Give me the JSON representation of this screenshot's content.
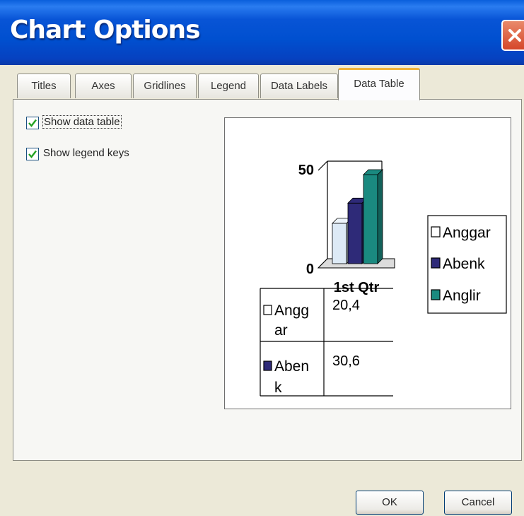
{
  "window": {
    "title": "Chart Options"
  },
  "tabs": [
    "Titles",
    "Axes",
    "Gridlines",
    "Legend",
    "Data Labels",
    "Data Table"
  ],
  "active_tab": "Data Table",
  "options": {
    "show_data_table": {
      "label": "Show data table",
      "checked": true
    },
    "show_legend_keys": {
      "label": "Show legend keys",
      "checked": true
    }
  },
  "preview": {
    "y_max_label": "50",
    "y_min_label": "0",
    "category_label": "1st Qtr",
    "legend": [
      {
        "label": "Anggar",
        "color": "#ffffff"
      },
      {
        "label": "Abenk",
        "color": "#2e2a78"
      },
      {
        "label": "Anglir",
        "color": "#1a8a80"
      }
    ],
    "table_rows": [
      {
        "key_color": "#ffffff",
        "name_line1": "Angg",
        "name_line2": "ar",
        "value": "20,4"
      },
      {
        "key_color": "#2e2a78",
        "name_line1": "Aben",
        "name_line2": "k",
        "value": "30,6"
      }
    ]
  },
  "chart_data": {
    "type": "bar",
    "categories": [
      "1st Qtr"
    ],
    "series": [
      {
        "name": "Anggar",
        "values": [
          20.4
        ]
      },
      {
        "name": "Abenk",
        "values": [
          30.6
        ]
      },
      {
        "name": "Anglir",
        "values": [
          45
        ]
      }
    ],
    "ylim": [
      0,
      50
    ],
    "yticks": [
      "0",
      "50"
    ],
    "style": "3d-column",
    "legend_position": "right",
    "data_table": true
  },
  "buttons": {
    "ok": "OK",
    "cancel": "Cancel"
  },
  "colors": {
    "titlebar": "#0054e3",
    "active_tab_accent": "#f1b33b",
    "dialog_bg": "#ece9d8"
  }
}
